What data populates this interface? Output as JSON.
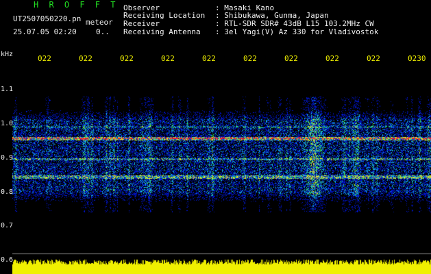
{
  "header": {
    "program": "H R O F F T",
    "filename": "UT2507050220.pn",
    "type": "meteor",
    "datetime": "25.07.05 02:20",
    "value": "0..",
    "fields": [
      {
        "label": "Observer",
        "value": ": Masaki Kano"
      },
      {
        "label": "Receiving Location",
        "value": ": Shibukawa, Gunma, Japan"
      },
      {
        "label": "Receiver",
        "value": ": RTL-SDR SDR# 43dB L15 103.2MHz CW"
      },
      {
        "label": "Receiving Antenna",
        "value": ": 3el Yagi(V) Az 330 for Vladivostok"
      }
    ]
  },
  "spectrogram": {
    "y_unit": "kHz",
    "y_ticks": [
      "1.1",
      "1.0",
      "0.9",
      "0.8",
      "0.7",
      "0.6"
    ],
    "time_ticks": [
      "022",
      "022",
      "022",
      "022",
      "022",
      "022",
      "022",
      "022",
      "022",
      "0230"
    ],
    "colors": {
      "background": "#000000",
      "noise": "#0018a0",
      "signal_red": "#ff2020",
      "bottom_bar": "#f0f000"
    }
  }
}
